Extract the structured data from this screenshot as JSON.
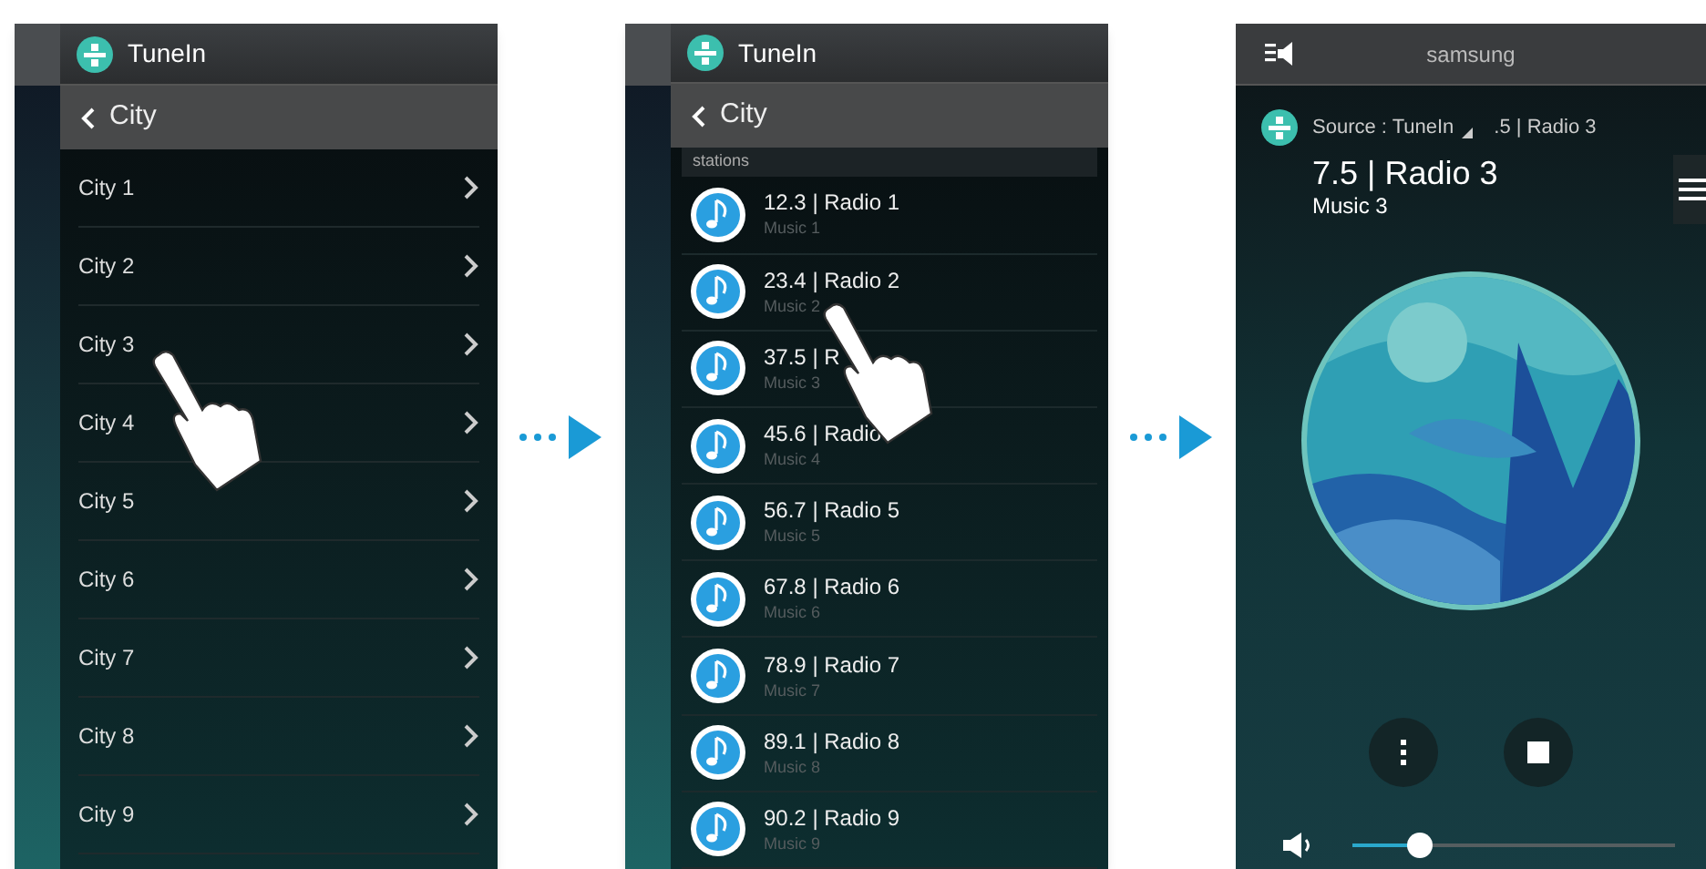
{
  "screens": [
    {
      "kind": "city_list",
      "app_title": "TuneIn",
      "back_title": "City",
      "items": [
        {
          "label": "City 1"
        },
        {
          "label": "City 2"
        },
        {
          "label": "City 3"
        },
        {
          "label": "City 4"
        },
        {
          "label": "City 5"
        },
        {
          "label": "City 6"
        },
        {
          "label": "City 7"
        },
        {
          "label": "City 8"
        },
        {
          "label": "City 9"
        }
      ]
    },
    {
      "kind": "station_list",
      "app_title": "TuneIn",
      "back_title": "City",
      "section": "stations",
      "stations": [
        {
          "title": "12.3 | Radio 1",
          "subtitle": "Music 1"
        },
        {
          "title": "23.4 | Radio 2",
          "subtitle": "Music 2"
        },
        {
          "title": "37.5 | R",
          "subtitle": "Music 3"
        },
        {
          "title": "45.6 | Radio",
          "subtitle": "Music 4"
        },
        {
          "title": "56.7 | Radio 5",
          "subtitle": "Music 5"
        },
        {
          "title": "67.8 | Radio 6",
          "subtitle": "Music 6"
        },
        {
          "title": "78.9 | Radio 7",
          "subtitle": "Music 7"
        },
        {
          "title": "89.1 | Radio 8",
          "subtitle": "Music 8"
        },
        {
          "title": "90.2 | Radio 9",
          "subtitle": "Music 9"
        }
      ]
    },
    {
      "kind": "player",
      "device": "samsung",
      "source": "Source : TuneIn",
      "mini_title": ".5 | Radio 3",
      "title": "7.5 | Radio 3",
      "subtitle": "Music 3",
      "volume": {
        "level": 0.21
      }
    }
  ]
}
